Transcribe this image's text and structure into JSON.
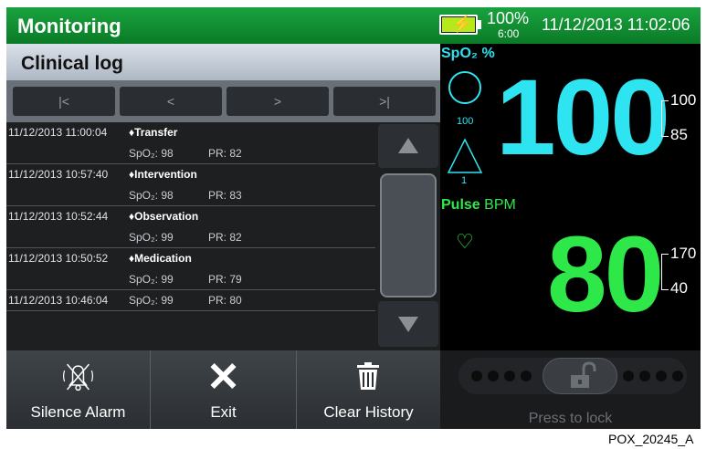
{
  "header": {
    "title": "Monitoring",
    "battery_percent": "100%",
    "battery_time": "6:00",
    "datetime": "11/12/2013 11:02:06"
  },
  "log": {
    "title": "Clinical log",
    "nav": {
      "first": "|<",
      "prev": "<",
      "next": ">",
      "last": ">|"
    },
    "entries": [
      {
        "time": "11/12/2013 11:00:04",
        "event": "♦Transfer",
        "spo2": "SpO₂: 98",
        "pr": "PR: 82"
      },
      {
        "time": "11/12/2013 10:57:40",
        "event": "♦Intervention",
        "spo2": "SpO₂: 98",
        "pr": "PR: 83"
      },
      {
        "time": "11/12/2013 10:52:44",
        "event": "♦Observation",
        "spo2": "SpO₂: 99",
        "pr": "PR: 82"
      },
      {
        "time": "11/12/2013 10:50:52",
        "event": "♦Medication",
        "spo2": "SpO₂: 99",
        "pr": "PR: 79"
      },
      {
        "time": "11/12/2013 10:46:04",
        "event": "",
        "spo2": "SpO₂: 99",
        "pr": "PR: 80"
      }
    ]
  },
  "vitals": {
    "spo2_label": "SpO₂ %",
    "spo2_value": "100",
    "spo2_high": "100",
    "spo2_low": "85",
    "spo2_circle_value": "100",
    "spo2_triangle_value": "1",
    "pulse_label_bold": "Pulse",
    "pulse_label_unit": "BPM",
    "pulse_value": "80",
    "pulse_high": "170",
    "pulse_low": "40",
    "spo2_color": "#2ee4f0",
    "pulse_color": "#2ee84a"
  },
  "actions": {
    "silence": "Silence Alarm",
    "exit": "Exit",
    "clear": "Clear History",
    "lock": "Press to lock"
  },
  "icons": {
    "battery": "battery-charging-icon",
    "silence": "bell-silence-icon",
    "exit": "x-icon",
    "clear": "trash-icon",
    "lock": "unlocked-padlock-icon",
    "heart": "heart-icon"
  },
  "footer": {
    "code": "POX_20245_A"
  }
}
